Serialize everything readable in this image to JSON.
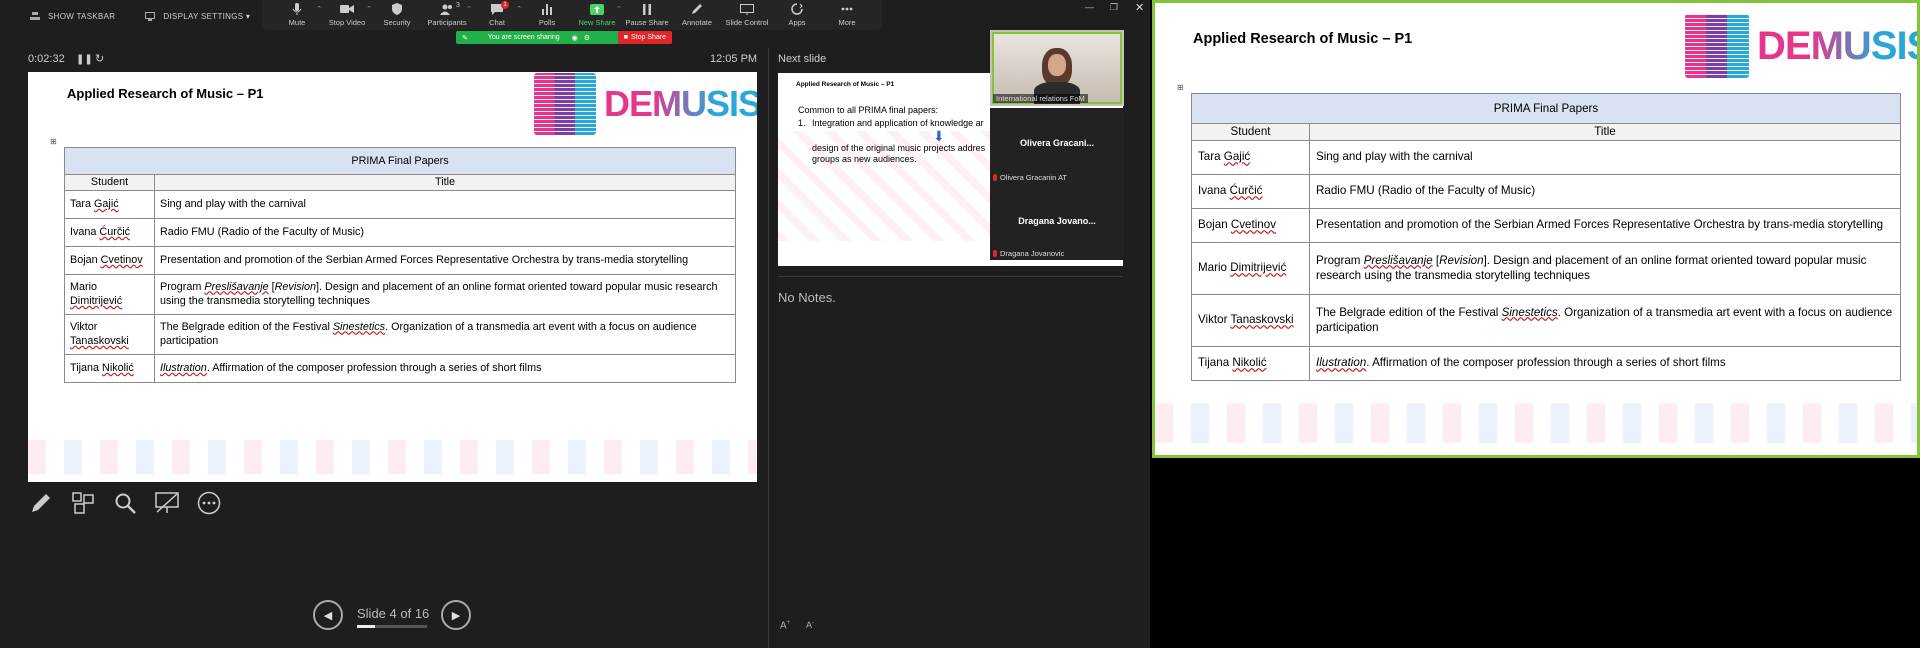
{
  "topbar": {
    "show_taskbar": "SHOW TASKBAR",
    "display_settings": "DISPLAY SETTINGS ▾"
  },
  "toolbar": [
    {
      "label": "Mute",
      "icon": "mic-icon"
    },
    {
      "label": "Stop Video",
      "icon": "video-icon"
    },
    {
      "label": "Security",
      "icon": "shield-icon"
    },
    {
      "label": "Participants",
      "icon": "participants-icon",
      "count": "3"
    },
    {
      "label": "Chat",
      "icon": "chat-icon",
      "badge": "1"
    },
    {
      "label": "Polls",
      "icon": "polls-icon"
    },
    {
      "label": "New Share",
      "icon": "new-share-icon"
    },
    {
      "label": "Pause Share",
      "icon": "pause-icon"
    },
    {
      "label": "Annotate",
      "icon": "annotate-icon"
    },
    {
      "label": "Slide Control",
      "icon": "slide-control-icon"
    },
    {
      "label": "Apps",
      "icon": "apps-icon"
    },
    {
      "label": "More",
      "icon": "more-icon"
    }
  ],
  "sharebar": {
    "text": "You are screen sharing",
    "stop": "Stop Share"
  },
  "presenter": {
    "elapsed": "0:02:32",
    "clock": "12:05 PM",
    "next_label": "Next slide",
    "notes": "No Notes.",
    "slide_counter": "Slide 4 of 16",
    "progress": 0.25
  },
  "slide": {
    "title": "Applied Research of Music – P1",
    "logo_text": "DEMUSIS",
    "caption": "PRIMA Final Papers",
    "col_student": "Student",
    "col_title": "Title",
    "rows": [
      {
        "first": "Tara",
        "last": "Gajić",
        "title": [
          {
            "t": "Sing and play with the carnival"
          }
        ]
      },
      {
        "first": "Ivana",
        "last": "Ćurčić",
        "title": [
          {
            "t": "Radio FMU (Radio of the Faculty of Music)"
          }
        ]
      },
      {
        "first": "Bojan",
        "last": "Cvetinov",
        "title": [
          {
            "t": "Presentation and promotion of the Serbian Armed Forces Representative Orchestra by trans-media storytelling"
          }
        ]
      },
      {
        "first": "Mario",
        "last": "Dimitrijević",
        "title": [
          {
            "t": "Program "
          },
          {
            "t": "Preslišavanje",
            "i": true,
            "u": true
          },
          {
            "t": " ["
          },
          {
            "t": "Revision",
            "i": true
          },
          {
            "t": "]. Design and placement of an online format oriented toward popular music research using the transmedia storytelling techniques"
          }
        ]
      },
      {
        "first": "Viktor",
        "last": "Tanaskovski",
        "title": [
          {
            "t": "The Belgrade edition of the Festival "
          },
          {
            "t": "Sinestetics",
            "i": true,
            "u": true
          },
          {
            "t": ". Organization of a transmedia art event with a focus on audience participation"
          }
        ]
      },
      {
        "first": "Tijana",
        "last": "Nikolić",
        "title": [
          {
            "t": "Ilustration",
            "i": true,
            "u": true
          },
          {
            "t": ". Affirmation of the composer profession through a series of short films"
          }
        ]
      }
    ]
  },
  "next_slide": {
    "title": "Applied Research of Music – P1",
    "lead": "Common to all PRIMA final papers:",
    "item_num": "1.",
    "item_text": "Integration and application of knowledge ar",
    "line2": "design of the original music projects addres",
    "line3": "groups as new audiences."
  },
  "participants": [
    {
      "label": "International relations FoM"
    },
    {
      "name": "Olivera  Gracani...",
      "label": "Olivera Gracanin AT"
    },
    {
      "name": "Dragana  Jovano...",
      "label": "Dragana Jovanovic"
    }
  ]
}
